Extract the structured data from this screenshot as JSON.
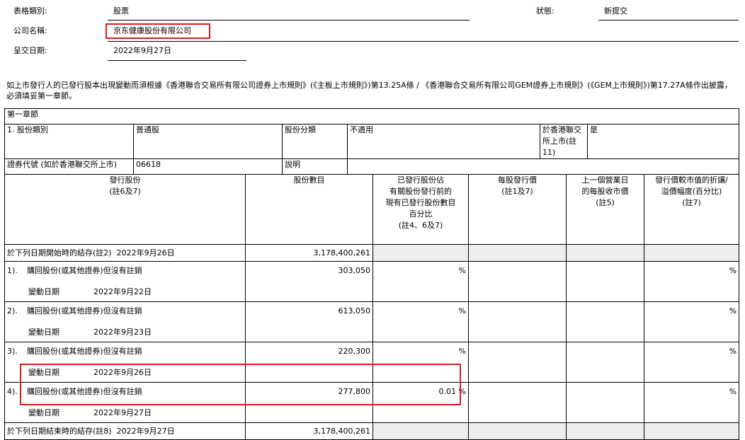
{
  "header": {
    "form_type_label": "表格類別:",
    "form_type_value": "股票",
    "status_label": "狀態:",
    "status_value": "新提交",
    "company_label": "公司名稱:",
    "company_value": "京东健康股份有限公司",
    "date_label": "呈交日期:",
    "date_value": "2022年9月27日"
  },
  "intro": "如上市發行人的已發行股本出現變動而須根據《香港聯合交易所有限公司證券上市規則》(《主板上市規則》)第13.25A條 / 《香港聯合交易所有限公司GEM證券上市規則》(《GEM上市規則》)第17.27A條作出披露，必須填妥第一章節。",
  "section": {
    "title": "第一章節",
    "share_class_label": "1. 股份類別",
    "share_class_value": "普通股",
    "share_category_label": "股份分類",
    "share_category_value": "不適用",
    "listed_label": "於香港聯交所上市(註11)",
    "listed_value": "是",
    "stock_code_label": "證券代號 (如於香港聯交所上市)",
    "stock_code_value": "06618",
    "description_label": "說明",
    "description_value": ""
  },
  "columns": {
    "issued_shares": "發行股份\n(註6及7)",
    "share_count": "股份數目",
    "percentage": "已發行股份佔\n有關股份發行前的\n現有已發行股份數目\n百分比\n(註4、6及7)",
    "issue_price": "每股發行價\n(註1及7)",
    "closing_price": "上一個營業日\n的每股收市價\n(註5)",
    "discount": "發行價較市值的折讓/\n溢價幅度(百分比)\n(註7)"
  },
  "opening": {
    "label": "於下列日期開始時的結存(註2)",
    "date": "2022年9月26日",
    "shares": "3,178,400,261"
  },
  "rows": [
    {
      "num": "1).",
      "desc": "購回股份(或其他證券)但沒有註銷",
      "change_label": "變動日期",
      "change_date": "2022年9月22日",
      "shares": "303,050",
      "pct": "%",
      "discount": "%"
    },
    {
      "num": "2).",
      "desc": "購回股份(或其他證券)但沒有註銷",
      "change_label": "變動日期",
      "change_date": "2022年9月23日",
      "shares": "613,050",
      "pct": "%",
      "discount": "%"
    },
    {
      "num": "3).",
      "desc": "購回股份(或其他證券)但沒有註銷",
      "change_label": "變動日期",
      "change_date": "2022年9月26日",
      "shares": "220,300",
      "pct": "%",
      "discount": "%"
    },
    {
      "num": "4).",
      "desc": "購回股份(或其他證券)但沒有註銷",
      "change_label": "變動日期",
      "change_date": "2022年9月27日",
      "shares": "277,800",
      "pct": "0.01 %",
      "discount": "%"
    }
  ],
  "closing": {
    "label": "於下列日期結束時的結存(註8)",
    "date": "2022年9月27日",
    "shares": "3,178,400,261"
  }
}
